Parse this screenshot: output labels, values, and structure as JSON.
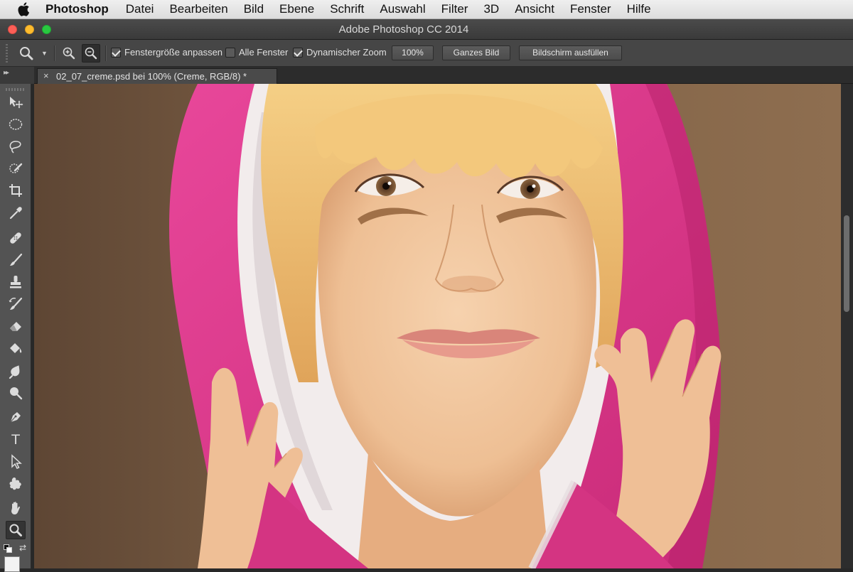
{
  "menubar": {
    "app_name": "Photoshop",
    "items": [
      "Datei",
      "Bearbeiten",
      "Bild",
      "Ebene",
      "Schrift",
      "Auswahl",
      "Filter",
      "3D",
      "Ansicht",
      "Fenster",
      "Hilfe"
    ]
  },
  "window": {
    "title": "Adobe Photoshop CC 2014"
  },
  "options_bar": {
    "fit_window_label": "Fenstergröße anpassen",
    "fit_window_checked": true,
    "all_windows_label": "Alle Fenster",
    "all_windows_checked": false,
    "scrubby_zoom_label": "Dynamischer Zoom",
    "scrubby_zoom_checked": true,
    "zoom_100_label": "100%",
    "fit_screen_label": "Ganzes Bild",
    "fill_screen_label": "Bildschirm ausfüllen"
  },
  "document_tab": {
    "close_symbol": "×",
    "title": "02_07_creme.psd bei 100% (Creme, RGB/8) *"
  },
  "toolbox": {
    "active_tool": "zoom-tool",
    "type_tool_glyph": "T",
    "swap_glyph": "⇄",
    "foreground_color": "#f3f3f3"
  },
  "colors": {
    "hoodie_pink": "#e33a8c",
    "background_brown": "#8c6c4e",
    "skin": "#f0c49c",
    "hair_blonde": "#f0c070"
  }
}
